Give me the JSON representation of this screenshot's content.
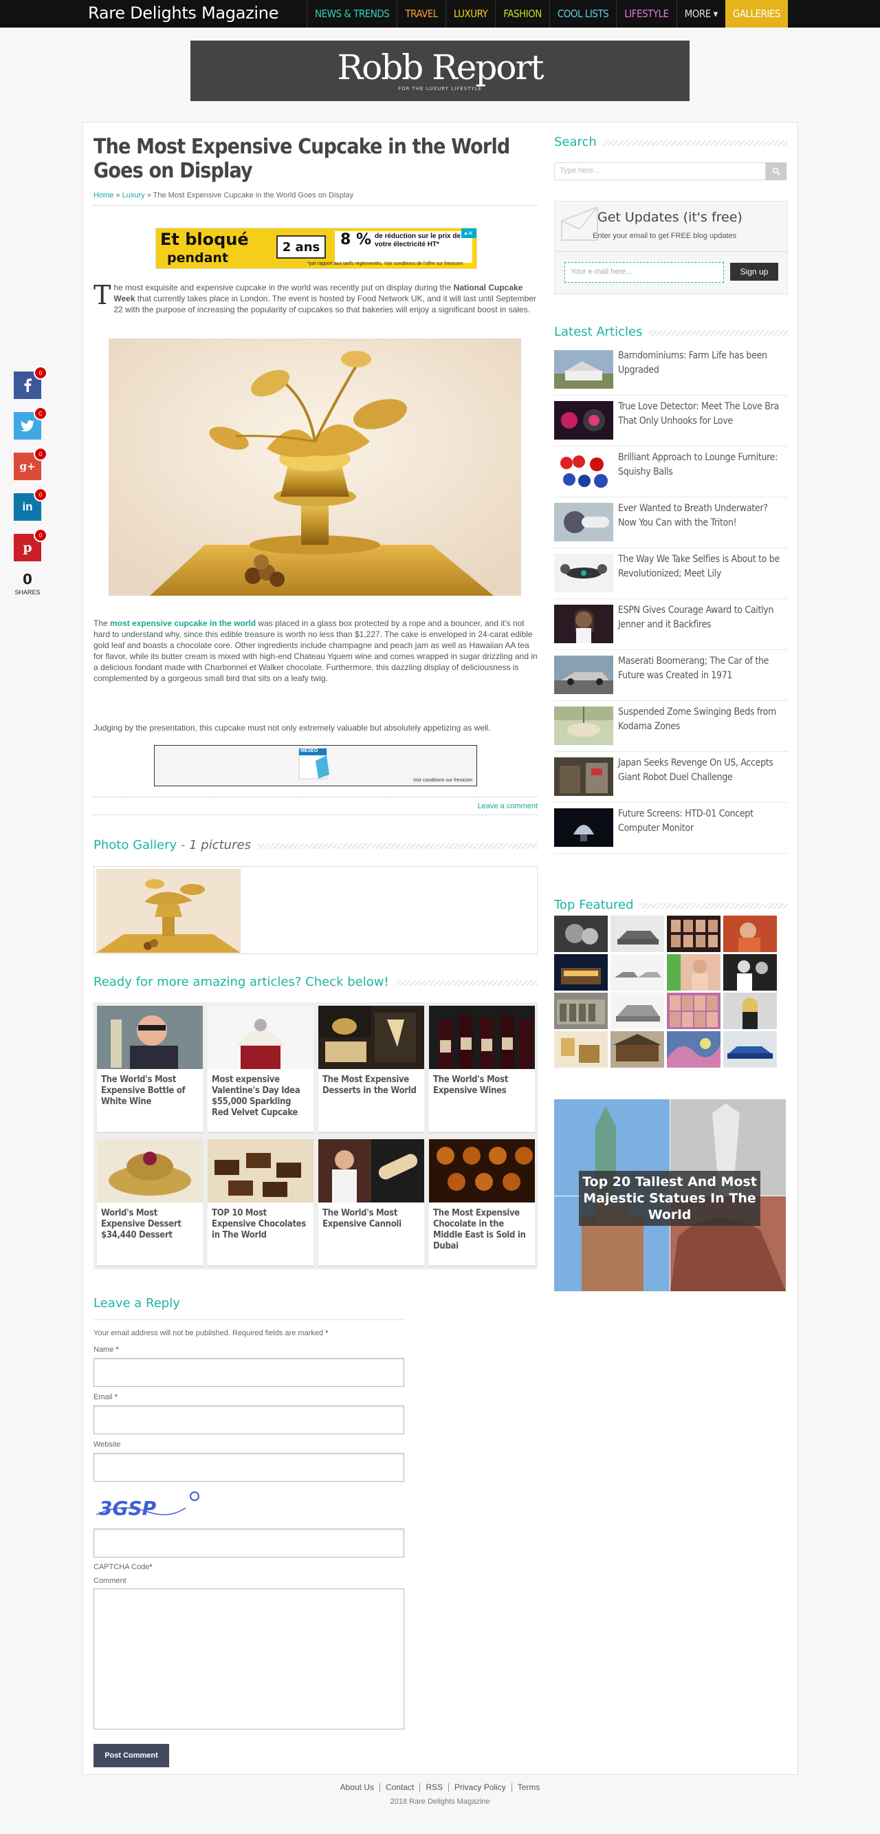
{
  "site": {
    "logo": "Rare Delights Magazine",
    "nav": [
      {
        "label": "NEWS & TRENDS",
        "color": "#2fd4b5"
      },
      {
        "label": "TRAVEL",
        "color": "#f0a23a"
      },
      {
        "label": "LUXURY",
        "color": "#f2d21b"
      },
      {
        "label": "FASHION",
        "color": "#b5e61d"
      },
      {
        "label": "COOL LISTS",
        "color": "#5ccfee"
      },
      {
        "label": "LIFESTYLE",
        "color": "#e07ae0"
      },
      {
        "label": "MORE ▾",
        "color": "#dddddd"
      },
      {
        "label": "GALLERIES",
        "color": "#ffffff"
      }
    ]
  },
  "banner": {
    "title": "Robb Report",
    "tagline": "FOR THE LUXURY LIFESTYLE"
  },
  "article": {
    "title": "The Most Expensive Cupcake in the World Goes on Display",
    "breadcrumb": {
      "home": "Home",
      "sep": "»",
      "category": "Luxury",
      "current": "The Most Expensive Cupcake in the World Goes on Display"
    },
    "intro_dropcap": "T",
    "intro_a": "he most exquisite and expensive cupcake in the world was recently put on display during the ",
    "intro_bold": "National Cupcake Week",
    "intro_b": " that currently takes place in London. The event is hosted by Food Network UK, and it will last until September 22 with the purpose of increasing the popularity of cupcakes so that bakeries will enjoy a significant boost in sales.",
    "p2_a": "The ",
    "p2_link": "most expensive cupcake in the world",
    "p2_b": " was placed in a glass box protected by a rope and a bouncer, and it's not hard to understand why, since this edible treasure is worth no less than $1,227. The cake is enveloped in 24-carat edible gold leaf and boasts a chocolate core. Other ingredients include champagne and peach jam as well as Hawaiian AA tea for flavor, while its butter cream is mixed with high-end Chateau Yquem wine and comes wrapped in sugar drizzling  and in a delicious fondant made with Charbonnel et Walker chocolate. Furthermore, this dazzling display of deliciousness is complemented by a gorgeous small bird that sits on a leafy twig.",
    "p3": "Judging by the presentation, this cupcake must not only extremely valuable but absolutely appetizing as well.",
    "leave_comment": "Leave a comment"
  },
  "ads": {
    "top_line1": "Et bloqué",
    "top_line2": "pendant",
    "top_box": "2 ans",
    "top_pct": "8 %",
    "top_small": "de réduction sur le prix de votre électricité HT*",
    "top_fine": "*par rapport aux tarifs réglementés. Voir conditions de l'offre sur frenicom",
    "mid_brand": "MESEO",
    "mid_fine": "Voir conditions sur frenicom"
  },
  "gallery": {
    "label": "Photo Gallery - ",
    "count": "1 pictures"
  },
  "related": {
    "heading": "Ready for more amazing articles? Check below!",
    "items": [
      {
        "title": "The World's Most Expensive Bottle of White Wine"
      },
      {
        "title": "Most expensive Valentine's Day Idea $55,000 Sparkling Red Velvet Cupcake"
      },
      {
        "title": "The Most Expensive Desserts in the World"
      },
      {
        "title": "The World's Most Expensive Wines"
      },
      {
        "title": "World's Most Expensive Dessert $34,440 Dessert"
      },
      {
        "title": "TOP 10 Most Expensive Chocolates in The World"
      },
      {
        "title": "The World's Most Expensive Cannoli"
      },
      {
        "title": "The Most Expensive Chocolate in the Middle East is Sold in Dubai"
      }
    ]
  },
  "reply": {
    "heading": "Leave a Reply",
    "note": "Your email address will not be published. Required fields are marked ",
    "req": "*",
    "name_label": "Name ",
    "email_label": "Email ",
    "website_label": "Website",
    "captcha_text": "3GSP",
    "captcha_label": "CAPTCHA Code",
    "comment_label": "Comment",
    "submit": "Post Comment"
  },
  "sidebar": {
    "search_heading": "Search",
    "search_placeholder": "Type here...",
    "updates_heading": "Get Updates (it's free)",
    "updates_sub": "Enter your email to get FREE blog updates",
    "email_placeholder": "Your e-mail here...",
    "signup": "Sign up",
    "latest_heading": "Latest Articles",
    "latest": [
      {
        "title": "Barndominiums: Farm Life has been Upgraded"
      },
      {
        "title": "True Love Detector: Meet The Love Bra That Only Unhooks for Love"
      },
      {
        "title": "Brilliant Approach to Lounge Furniture: Squishy Balls"
      },
      {
        "title": "Ever Wanted to Breath Underwater? Now You Can with the Triton!"
      },
      {
        "title": "The Way We Take Selfies is About to be Revolutionized; Meet Lily"
      },
      {
        "title": "ESPN Gives Courage Award to Caitlyn Jenner and it Backfires"
      },
      {
        "title": "Maserati Boomerang; The Car of the Future was Created in 1971"
      },
      {
        "title": "Suspended Zome Swinging Beds from Kodama Zones"
      },
      {
        "title": "Japan Seeks Revenge On US, Accepts Giant Robot Duel Challenge"
      },
      {
        "title": "Future Screens: HTD-01 Concept Computer Monitor"
      }
    ],
    "featured_heading": "Top Featured",
    "statues_caption": "Top 20 Tallest And Most Majestic Statues In The World"
  },
  "share": {
    "counts": [
      "0",
      "C",
      "0",
      "0",
      "0"
    ],
    "total": "0",
    "label": "SHARES"
  },
  "footer": {
    "links": [
      "About Us",
      "Contact",
      "RSS",
      "Privacy Policy",
      "Terms"
    ],
    "copyright": "2018 Rare Delights Magazine"
  }
}
